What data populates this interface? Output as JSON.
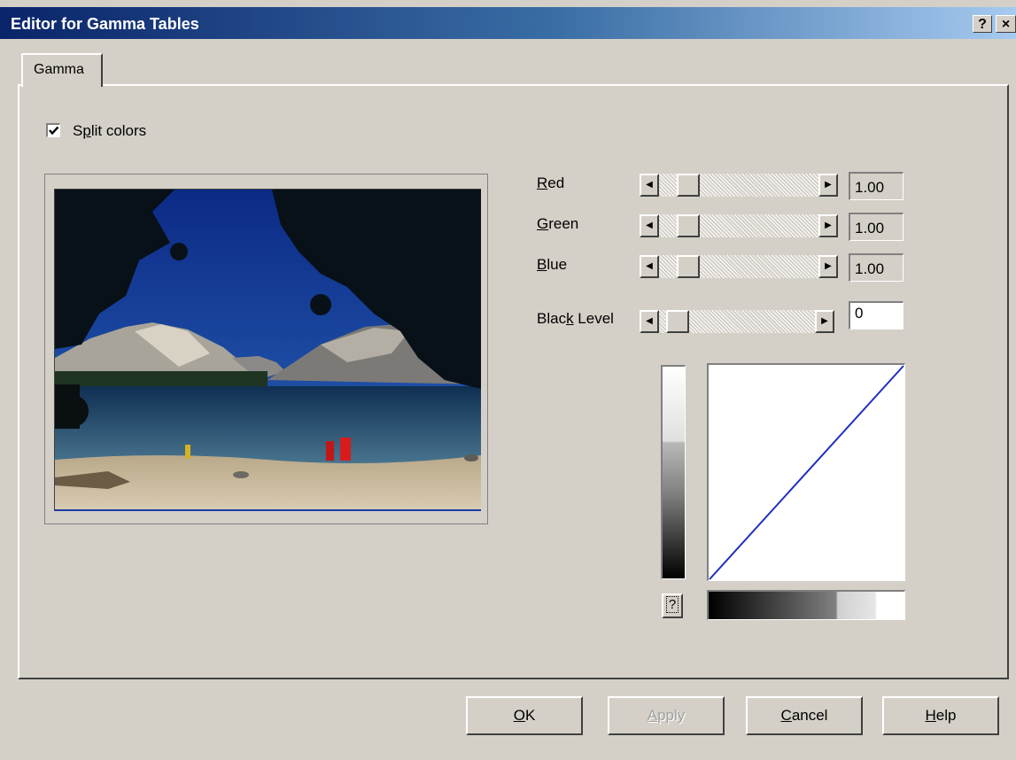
{
  "window": {
    "title": "Editor for Gamma Tables",
    "help_glyph": "?",
    "close_glyph": "×"
  },
  "tabs": [
    {
      "label": "Gamma"
    }
  ],
  "split_colors": {
    "label_pre": "S",
    "label_u": "p",
    "label_post": "lit colors",
    "checked": true
  },
  "sliders": [
    {
      "label_u": "R",
      "label_post": "ed",
      "value": "1.00"
    },
    {
      "label_u": "G",
      "label_post": "reen",
      "value": "1.00"
    },
    {
      "label_u": "B",
      "label_post": "lue",
      "value": "1.00"
    }
  ],
  "black_level": {
    "label_pre": "Blac",
    "label_u": "k",
    "label_post": " Level",
    "value": "0"
  },
  "reset_button": {
    "label": "?"
  },
  "buttons": {
    "ok": {
      "u": "O",
      "rest": "K"
    },
    "apply": {
      "u": "A",
      "rest": "pply"
    },
    "cancel": {
      "u": "C",
      "rest": "ancel"
    },
    "help": {
      "u": "H",
      "rest": "elp"
    }
  },
  "icons": {
    "left_arrow": "◀",
    "right_arrow": "▶"
  },
  "colors": {
    "titlebar_start": "#0a246a",
    "face": "#d4d0c8",
    "curve": "#1f2fbf"
  }
}
